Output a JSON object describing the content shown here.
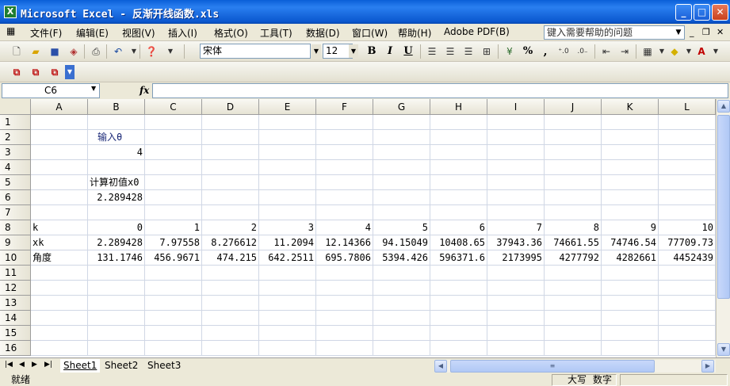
{
  "window": {
    "title": "Microsoft Excel - 反渐开线函数.xls",
    "app_icon": "X"
  },
  "menu": {
    "items": [
      "文件(F)",
      "编辑(E)",
      "视图(V)",
      "插入(I)",
      "格式(O)",
      "工具(T)",
      "数据(D)",
      "窗口(W)",
      "帮助(H)",
      "Adobe PDF(B)"
    ],
    "help_placeholder": "键入需要帮助的问题"
  },
  "format_toolbar": {
    "font_name": "宋体",
    "font_size": "12",
    "bold": "B",
    "italic": "I",
    "underline": "U",
    "percent": "%",
    "comma": ","
  },
  "formula_bar": {
    "cell_ref": "C6",
    "fx": "fx",
    "content": ""
  },
  "sheet": {
    "columns": [
      "A",
      "B",
      "C",
      "D",
      "E",
      "F",
      "G",
      "H",
      "I",
      "J",
      "K",
      "L"
    ],
    "rows": [
      "1",
      "2",
      "3",
      "4",
      "5",
      "6",
      "7",
      "8",
      "9",
      "10",
      "11",
      "12",
      "13",
      "14",
      "15",
      "16"
    ],
    "cells": {
      "B2": "输入θ",
      "B3": "4",
      "B5": "计算初值x0",
      "B6": "2.289428",
      "A8": "k",
      "B8": "0",
      "C8": "1",
      "D8": "2",
      "E8": "3",
      "F8": "4",
      "G8": "5",
      "H8": "6",
      "I8": "7",
      "J8": "8",
      "K8": "9",
      "L8": "10",
      "A9": "xk",
      "B9": "2.289428",
      "C9": "7.97558",
      "D9": "8.276612",
      "E9": "11.2094",
      "F9": "12.14366",
      "G9": "94.15049",
      "H9": "10408.65",
      "I9": "37943.36",
      "J9": "74661.55",
      "K9": "74746.54",
      "L9": "77709.73",
      "A10": "角度",
      "B10": "131.1746",
      "C10": "456.9671",
      "D10": "474.215",
      "E10": "642.2511",
      "F10": "695.7806",
      "G10": "5394.426",
      "H10": "596371.6",
      "I10": "2173995",
      "J10": "4277792",
      "K10": "4282661",
      "L10": "4452439"
    }
  },
  "sheet_tabs": [
    "Sheet1",
    "Sheet2",
    "Sheet3"
  ],
  "status": {
    "ready": "就绪",
    "caps": "大写",
    "num": "数字"
  }
}
